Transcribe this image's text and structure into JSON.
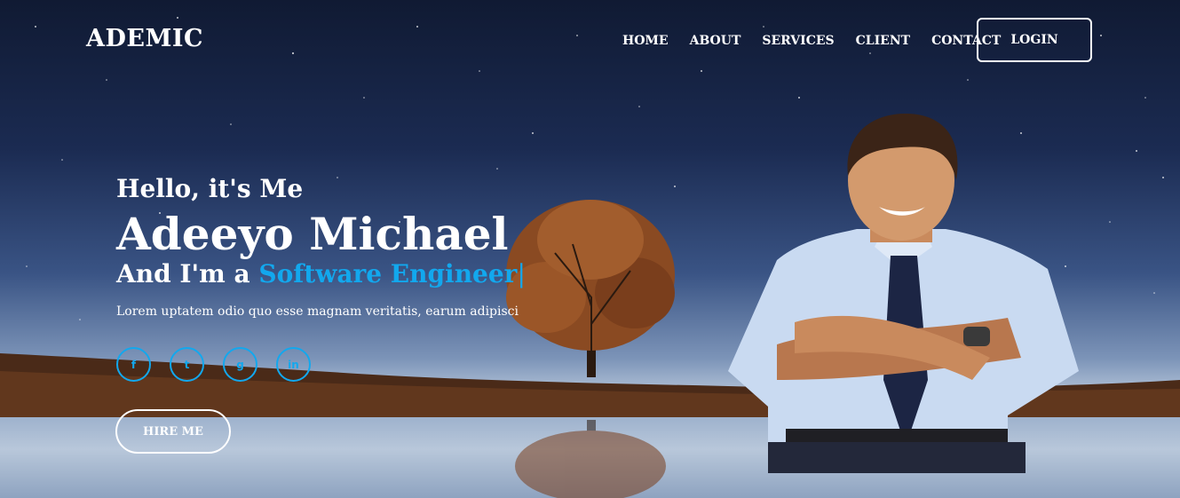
{
  "brand": {
    "logo": "ADEMIC"
  },
  "nav": {
    "items": [
      {
        "label": "HOME"
      },
      {
        "label": "ABOUT"
      },
      {
        "label": "SERVICES"
      },
      {
        "label": "CLIENT"
      },
      {
        "label": "CONTACT"
      }
    ],
    "login_label": "LOGIN"
  },
  "hero": {
    "greeting": "Hello, it's Me",
    "name": "Adeeyo Michael",
    "role_prefix": "And I'm a ",
    "role_highlight": "Software Engineer",
    "role_cursor": "|",
    "description": "Lorem uptatem odio quo esse magnam veritatis, earum adipisci",
    "socials": [
      {
        "icon": "facebook-icon",
        "glyph": "f"
      },
      {
        "icon": "twitter-icon",
        "glyph": "t"
      },
      {
        "icon": "github-icon",
        "glyph": "g"
      },
      {
        "icon": "linkedin-icon",
        "glyph": "in"
      }
    ],
    "hire_label": "HIRE ME"
  },
  "colors": {
    "accent": "#12a8ee",
    "text": "#ffffff"
  }
}
